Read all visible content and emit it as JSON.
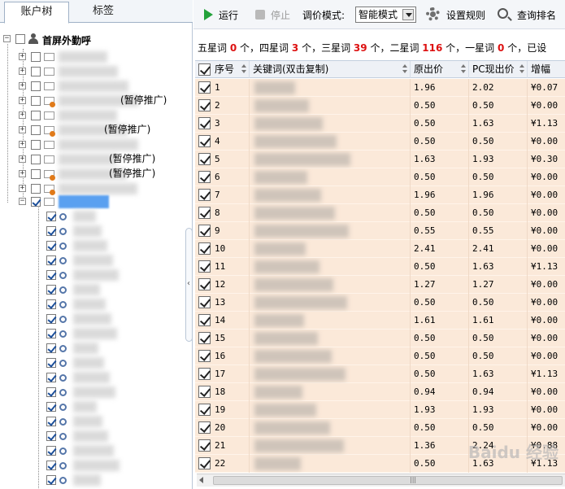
{
  "tabs": {
    "account_tree": "账户树",
    "tags": "标签"
  },
  "tree": {
    "root_label": "首屏外勤呼",
    "paused_label": "(暂停推广)"
  },
  "toolbar": {
    "run": "运行",
    "stop": "停止",
    "bid_mode_label": "调价模式:",
    "bid_mode_value": "智能模式",
    "set_rules": "设置规则",
    "query_rank": "查询排名"
  },
  "summary": {
    "five_star_label": "五星词",
    "five_star": "0",
    "four_star_label": "个，四星词",
    "four_star": "3",
    "three_star_label": "个，三星词",
    "three_star": "39",
    "two_star_label": "个，二星词",
    "two_star": "116",
    "one_star_label": "个，一星词",
    "one_star": "0",
    "tail": "个，已设"
  },
  "grid": {
    "headers": [
      "序号",
      "关键词(双击复制)",
      "原出价",
      "PC现出价",
      "增幅"
    ],
    "rows": [
      {
        "n": "1",
        "orig": "1.96",
        "pc": "2.02",
        "inc": "¥0.07"
      },
      {
        "n": "2",
        "orig": "0.50",
        "pc": "0.50",
        "inc": "¥0.00"
      },
      {
        "n": "3",
        "orig": "0.50",
        "pc": "1.63",
        "inc": "¥1.13"
      },
      {
        "n": "4",
        "orig": "0.50",
        "pc": "0.50",
        "inc": "¥0.00"
      },
      {
        "n": "5",
        "orig": "1.63",
        "pc": "1.93",
        "inc": "¥0.30"
      },
      {
        "n": "6",
        "orig": "0.50",
        "pc": "0.50",
        "inc": "¥0.00"
      },
      {
        "n": "7",
        "orig": "1.96",
        "pc": "1.96",
        "inc": "¥0.00"
      },
      {
        "n": "8",
        "orig": "0.50",
        "pc": "0.50",
        "inc": "¥0.00"
      },
      {
        "n": "9",
        "orig": "0.55",
        "pc": "0.55",
        "inc": "¥0.00"
      },
      {
        "n": "10",
        "orig": "2.41",
        "pc": "2.41",
        "inc": "¥0.00"
      },
      {
        "n": "11",
        "orig": "0.50",
        "pc": "1.63",
        "inc": "¥1.13"
      },
      {
        "n": "12",
        "orig": "1.27",
        "pc": "1.27",
        "inc": "¥0.00"
      },
      {
        "n": "13",
        "orig": "0.50",
        "pc": "0.50",
        "inc": "¥0.00"
      },
      {
        "n": "14",
        "orig": "1.61",
        "pc": "1.61",
        "inc": "¥0.00"
      },
      {
        "n": "15",
        "orig": "0.50",
        "pc": "0.50",
        "inc": "¥0.00"
      },
      {
        "n": "16",
        "orig": "0.50",
        "pc": "0.50",
        "inc": "¥0.00"
      },
      {
        "n": "17",
        "orig": "0.50",
        "pc": "1.63",
        "inc": "¥1.13"
      },
      {
        "n": "18",
        "orig": "0.94",
        "pc": "0.94",
        "inc": "¥0.00"
      },
      {
        "n": "19",
        "orig": "1.93",
        "pc": "1.93",
        "inc": "¥0.00"
      },
      {
        "n": "20",
        "orig": "0.50",
        "pc": "0.50",
        "inc": "¥0.00"
      },
      {
        "n": "21",
        "orig": "1.36",
        "pc": "2.24",
        "inc": "¥0.88"
      },
      {
        "n": "22",
        "orig": "0.50",
        "pc": "1.63",
        "inc": "¥1.13"
      }
    ]
  },
  "watermark": "Baidu 经验"
}
